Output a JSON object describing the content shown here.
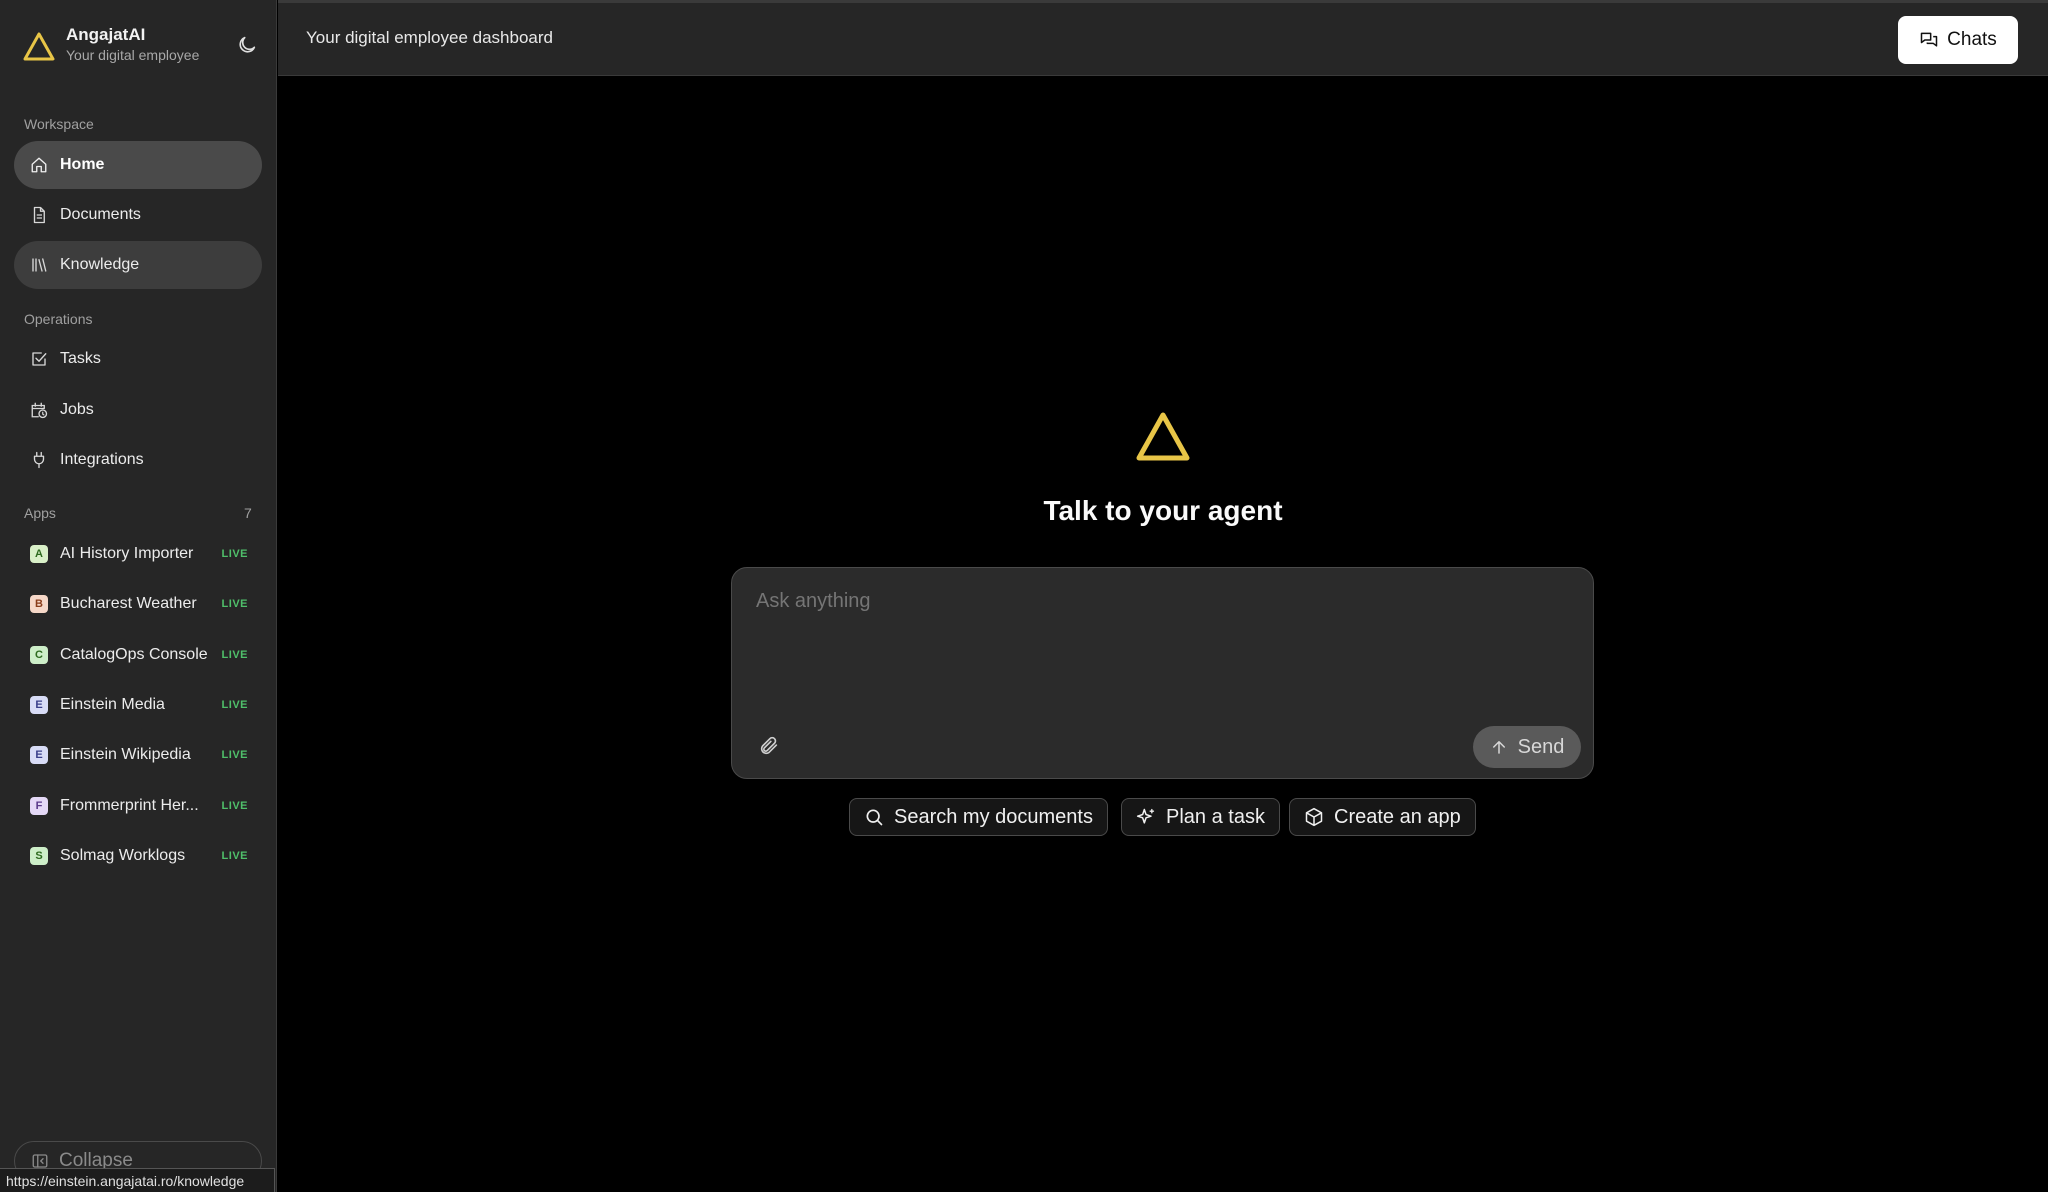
{
  "brand": {
    "name": "AngajatAI",
    "subtitle": "Your digital employee"
  },
  "header": {
    "title": "Your digital employee dashboard",
    "chats_label": "Chats"
  },
  "sidebar": {
    "workspace_label": "Workspace",
    "workspace_items": [
      {
        "label": "Home",
        "icon": "home-icon",
        "state": "active"
      },
      {
        "label": "Documents",
        "icon": "document-icon",
        "state": "normal"
      },
      {
        "label": "Knowledge",
        "icon": "library-icon",
        "state": "hover"
      }
    ],
    "operations_label": "Operations",
    "operations_items": [
      {
        "label": "Tasks",
        "icon": "checkbox-icon"
      },
      {
        "label": "Jobs",
        "icon": "calendar-clock-icon"
      },
      {
        "label": "Integrations",
        "icon": "plug-icon"
      }
    ],
    "apps_label": "Apps",
    "apps_count": "7",
    "apps": [
      {
        "letter": "A",
        "label": "AI History Importer",
        "status": "LIVE",
        "badge_color": "#d9f0c8",
        "badge_text": "#2d6a1e"
      },
      {
        "letter": "B",
        "label": "Bucharest Weather",
        "status": "LIVE",
        "badge_color": "#f6d8c8",
        "badge_text": "#8a3d1a"
      },
      {
        "letter": "C",
        "label": "CatalogOps Console",
        "status": "LIVE",
        "badge_color": "#cdeec8",
        "badge_text": "#2d6a1e"
      },
      {
        "letter": "E",
        "label": "Einstein Media",
        "status": "LIVE",
        "badge_color": "#d8dcf6",
        "badge_text": "#3a3f8a"
      },
      {
        "letter": "E",
        "label": "Einstein Wikipedia",
        "status": "LIVE",
        "badge_color": "#d8dcf6",
        "badge_text": "#3a3f8a"
      },
      {
        "letter": "F",
        "label": "Frommerprint Her...",
        "status": "LIVE",
        "badge_color": "#e4d8f6",
        "badge_text": "#5a3a8a"
      },
      {
        "letter": "S",
        "label": "Solmag Worklogs",
        "status": "LIVE",
        "badge_color": "#cdeec8",
        "badge_text": "#2d6a1e"
      }
    ],
    "collapse_label": "Collapse"
  },
  "main": {
    "title": "Talk to your agent",
    "input_placeholder": "Ask anything",
    "send_label": "Send",
    "suggestions": [
      {
        "label": "Search my documents",
        "icon": "search-icon"
      },
      {
        "label": "Plan a task",
        "icon": "sparkles-icon"
      },
      {
        "label": "Create an app",
        "icon": "box-icon"
      }
    ]
  },
  "status_bar": {
    "url": "https://einstein.angajatai.ro/knowledge"
  },
  "colors": {
    "accent": "#e8c547",
    "live": "#4fbf6a"
  }
}
